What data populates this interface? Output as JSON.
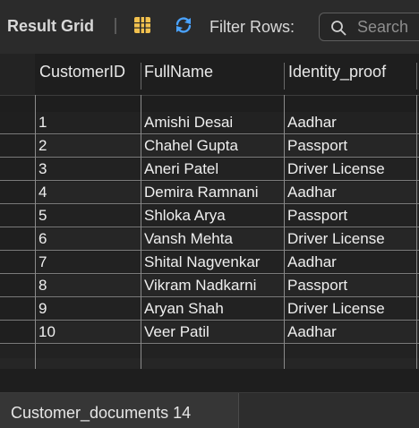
{
  "toolbar": {
    "title": "Result Grid",
    "filter_label": "Filter Rows:",
    "search_placeholder": "Search"
  },
  "grid": {
    "columns": [
      "CustomerID",
      "FullName",
      "Identity_proof"
    ],
    "rows": [
      {
        "id": "1",
        "name": "Amishi Desai",
        "proof": "Aadhar"
      },
      {
        "id": "2",
        "name": "Chahel Gupta",
        "proof": "Passport"
      },
      {
        "id": "3",
        "name": "Aneri Patel",
        "proof": "Driver License"
      },
      {
        "id": "4",
        "name": "Demira Ramnani",
        "proof": "Aadhar"
      },
      {
        "id": "5",
        "name": "Shloka Arya",
        "proof": "Passport"
      },
      {
        "id": "6",
        "name": "Vansh Mehta",
        "proof": "Driver License"
      },
      {
        "id": "7",
        "name": "Shital Nagvenkar",
        "proof": "Aadhar"
      },
      {
        "id": "8",
        "name": "Vikram Nadkarni",
        "proof": "Passport"
      },
      {
        "id": "9",
        "name": "Aryan Shah",
        "proof": "Driver License"
      },
      {
        "id": "10",
        "name": "Veer Patil",
        "proof": "Aadhar"
      }
    ]
  },
  "tabs": [
    {
      "label": "Customer_documents 14"
    }
  ],
  "icons": {
    "grid": "grid-layout-icon",
    "refresh": "refresh-icon",
    "search": "search-icon"
  },
  "colors": {
    "background": "#1e1e1e",
    "grid_icon": "#f2c14e",
    "refresh_icon": "#4aa3ff"
  }
}
